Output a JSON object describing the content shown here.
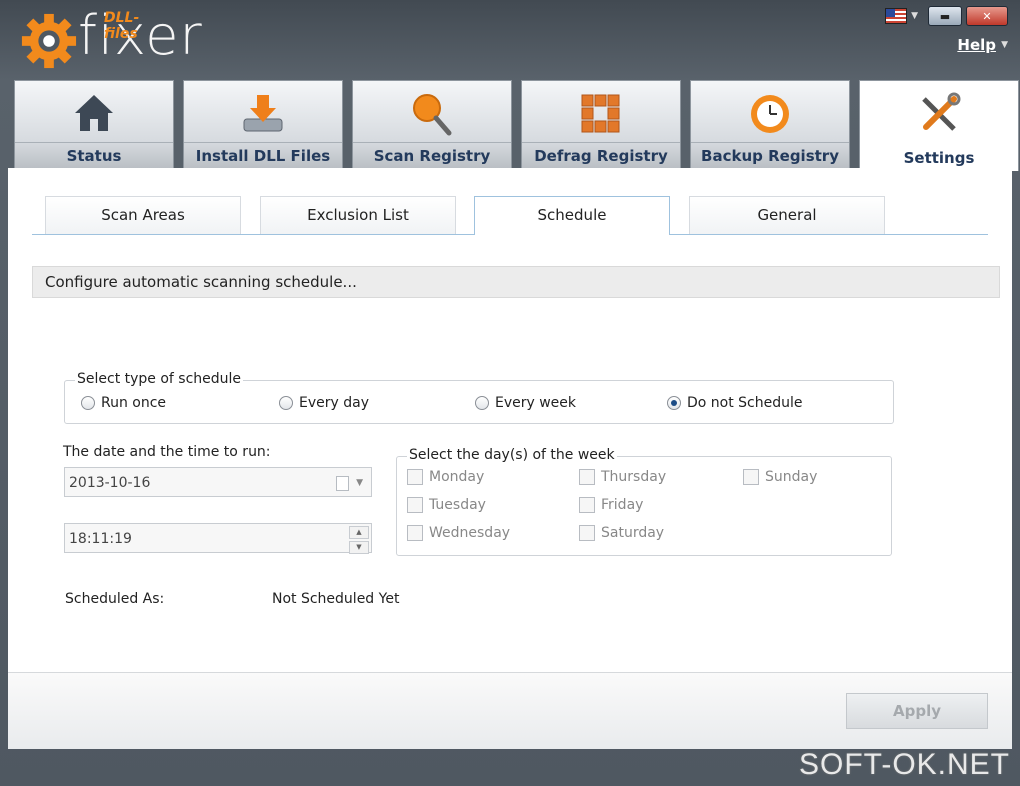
{
  "app": {
    "brand": "fixer",
    "brand_sub": "DLL-files",
    "help_label": "Help",
    "window_controls": [
      "minimize",
      "maximize",
      "close"
    ],
    "language_flag": "us-flag-icon"
  },
  "main_tabs": [
    {
      "label": "Status",
      "icon": "house-icon"
    },
    {
      "label": "Install DLL Files",
      "icon": "download-drive-icon"
    },
    {
      "label": "Scan Registry",
      "icon": "magnifier-icon"
    },
    {
      "label": "Defrag Registry",
      "icon": "blocks-icon"
    },
    {
      "label": "Backup Registry",
      "icon": "clock-restore-icon"
    },
    {
      "label": "Settings",
      "icon": "tools-icon",
      "active": true
    }
  ],
  "sub_tabs": [
    {
      "label": "Scan Areas"
    },
    {
      "label": "Exclusion List"
    },
    {
      "label": "Schedule",
      "active": true
    },
    {
      "label": "General"
    }
  ],
  "config_header": "Configure automatic scanning schedule...",
  "schedule_type": {
    "title": "Select type of schedule",
    "options": [
      {
        "label": "Run once",
        "selected": false
      },
      {
        "label": "Every day",
        "selected": false
      },
      {
        "label": "Every week",
        "selected": false
      },
      {
        "label": "Do not Schedule",
        "selected": true
      }
    ]
  },
  "datetime": {
    "label": "The date and the time to run:",
    "date": "2013-10-16",
    "time": "18:11:19"
  },
  "weekdays": {
    "title": "Select the day(s) of the week",
    "days": [
      "Monday",
      "Tuesday",
      "Wednesday",
      "Thursday",
      "Friday",
      "Saturday",
      "Sunday"
    ]
  },
  "scheduled_as": {
    "label": "Scheduled As:",
    "value": "Not Scheduled Yet"
  },
  "apply_label": "Apply",
  "watermark": "SOFT-OK.NET",
  "colors": {
    "accent_orange": "#f28a1c",
    "tab_text": "#233a5c",
    "frame": "#4f5861"
  }
}
